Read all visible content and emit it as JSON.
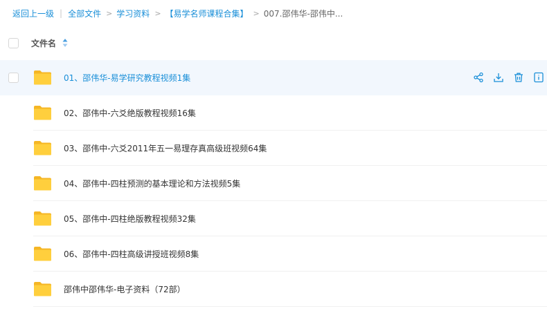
{
  "breadcrumb": {
    "back": "返回上一级",
    "items": [
      "全部文件",
      "学习资料",
      "【易学名师课程合集】",
      "007.邵伟华-邵伟中..."
    ]
  },
  "header": {
    "name_label": "文件名"
  },
  "files": [
    {
      "name": "01、邵伟华-易学研究教程视频1集",
      "icon": "folder-icon"
    },
    {
      "name": "02、邵伟中-六爻绝版教程视频16集",
      "icon": "folder-icon"
    },
    {
      "name": "03、邵伟中-六爻2011年五一易理存真高级班视频64集",
      "icon": "folder-icon"
    },
    {
      "name": "04、邵伟中-四柱预测的基本理论和方法视频5集",
      "icon": "folder-icon"
    },
    {
      "name": "05、邵伟中-四柱绝版教程视频32集",
      "icon": "folder-icon"
    },
    {
      "name": "06、邵伟中-四柱高级讲授班视频8集",
      "icon": "folder-icon"
    },
    {
      "name": "邵伟中邵伟华-电子资料（72部）",
      "icon": "folder-icon"
    }
  ],
  "row_actions": [
    "share-icon",
    "download-icon",
    "delete-icon",
    "more-icon"
  ],
  "colors": {
    "link": "#1a8fd8",
    "hover_row": "#f2f7fd",
    "folder": "#ffc933"
  }
}
